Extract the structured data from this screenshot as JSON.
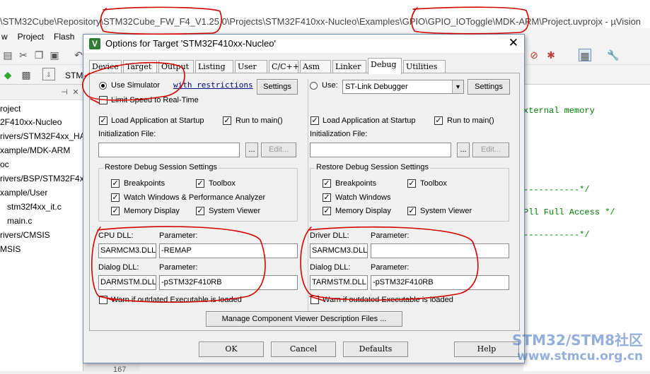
{
  "ide": {
    "title": "\\STM32Cube\\Repository\\STM32Cube_FW_F4_V1.25.0\\Projects\\STM32F410xx-Nucleo\\Examples\\GPIO\\GPIO_IOToggle\\MDK-ARM\\Project.uvprojx - µVision",
    "menu": [
      "w",
      "Project",
      "Flash"
    ],
    "toolbar_label": "STM",
    "project_tree": [
      "roject",
      "2F410xx-Nucleo",
      "rivers/STM32F4xx_HA",
      "xample/MDK-ARM",
      "oc",
      "rivers/BSP/STM32F4x",
      "xample/User",
      "stm32f4xx_it.c",
      "main.c",
      "rivers/CMSIS",
      "MSIS"
    ],
    "code_lines": [
      "xternal memory",
      "-----------*/",
      "Pll Full Access */",
      "-----------*/"
    ],
    "line_number": "167"
  },
  "dialog": {
    "title": "Options for Target 'STM32F410xx-Nucleo'",
    "close_glyph": "✕",
    "tabs": [
      "Device",
      "Target",
      "Output",
      "Listing",
      "User",
      "C/C++",
      "Asm",
      "Linker",
      "Debug",
      "Utilities"
    ],
    "active_tab": "Debug",
    "left": {
      "use_label": "Use Simulator",
      "use_checked": true,
      "restrictions_link": "with restrictions",
      "settings_label": "Settings",
      "limit_speed_label": "Limit Speed to Real-Time",
      "limit_speed_checked": false,
      "load_app_label": "Load Application at Startup",
      "load_app_checked": true,
      "run_main_label": "Run to main()",
      "run_main_checked": true,
      "init_file_label": "Initialization File:",
      "init_file_value": "",
      "browse_label": "...",
      "edit_label": "Edit...",
      "restore_group_label": "Restore Debug Session Settings",
      "restore": {
        "breakpoints": "Breakpoints",
        "toolbox": "Toolbox",
        "watch": "Watch Windows & Performance Analyzer",
        "memory": "Memory Display",
        "sysview": "System Viewer"
      },
      "cpu_dll_label": "CPU DLL:",
      "cpu_param_label": "Parameter:",
      "cpu_dll_value": "SARMCM3.DLL",
      "cpu_param_value": "-REMAP",
      "dialog_dll_label": "Dialog DLL:",
      "dialog_param_label": "Parameter:",
      "dialog_dll_value": "DARMSTM.DLL",
      "dialog_param_value": "-pSTM32F410RB",
      "warn_label": "Warn if outdated Executable is loaded",
      "warn_checked": false
    },
    "right": {
      "use_label": "Use:",
      "use_checked": false,
      "debugger_value": "ST-Link Debugger",
      "settings_label": "Settings",
      "load_app_label": "Load Application at Startup",
      "load_app_checked": true,
      "run_main_label": "Run to main()",
      "run_main_checked": true,
      "init_file_label": "Initialization File:",
      "init_file_value": "",
      "browse_label": "...",
      "edit_label": "Edit...",
      "restore_group_label": "Restore Debug Session Settings",
      "restore": {
        "breakpoints": "Breakpoints",
        "toolbox": "Toolbox",
        "watch": "Watch Windows",
        "memory": "Memory Display",
        "sysview": "System Viewer"
      },
      "driver_dll_label": "Driver DLL:",
      "driver_param_label": "Parameter:",
      "driver_dll_value": "SARMCM3.DLL",
      "driver_param_value": "",
      "dialog_dll_label": "Dialog DLL:",
      "dialog_param_label": "Parameter:",
      "dialog_dll_value": "TARMSTM.DLL",
      "dialog_param_value": "-pSTM32F410RB",
      "warn_label": "Warn if outdated Executable is loaded",
      "warn_checked": false
    },
    "manage_button": "Manage Component Viewer Description Files ...",
    "ok_button": "OK",
    "cancel_button": "Cancel",
    "defaults_button": "Defaults",
    "help_button": "Help"
  },
  "watermark": {
    "line1": "STM32/STM8社区",
    "line2": "www.stmcu.org.cn"
  },
  "annotation_color": "#d40000"
}
